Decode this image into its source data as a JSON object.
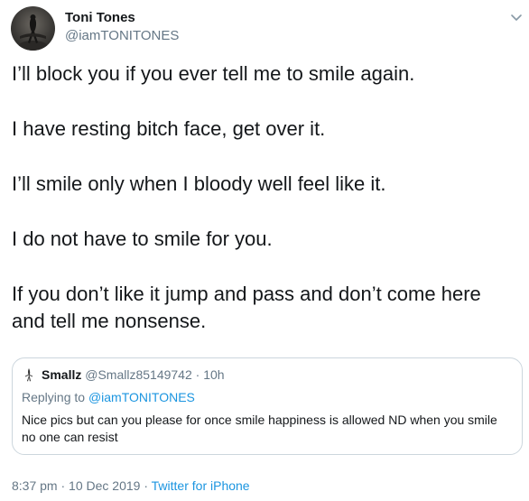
{
  "author": {
    "display_name": "Toni Tones",
    "handle": "@iamTONITONES"
  },
  "tweet": {
    "paragraphs": [
      "I’ll block you if you ever tell me to smile again.",
      "I have resting bitch face, get over it.",
      "I’ll smile only when I bloody well feel like it.",
      "I do not have to smile for you.",
      "If you don’t like it jump and pass and don’t come here and tell me nonsense."
    ]
  },
  "quoted": {
    "display_name": "Smallz",
    "handle": "@Smallz85149742",
    "separator": "·",
    "time": "10h",
    "replying_prefix": "Replying to ",
    "replying_to": "@iamTONITONES",
    "text": "Nice pics but can you please for once smile happiness is allowed ND when you smile no one can resist"
  },
  "meta": {
    "time": "8:37 pm",
    "separator": "·",
    "date": "10 Dec 2019",
    "source": "Twitter for iPhone"
  },
  "colors": {
    "text": "#14171a",
    "secondary": "#657786",
    "link": "#1b95e0",
    "border": "#ccd6dd"
  },
  "icons": {
    "menu": "chevron-down-icon",
    "author_avatar": "avatar",
    "quoted_avatar": "avatar"
  }
}
